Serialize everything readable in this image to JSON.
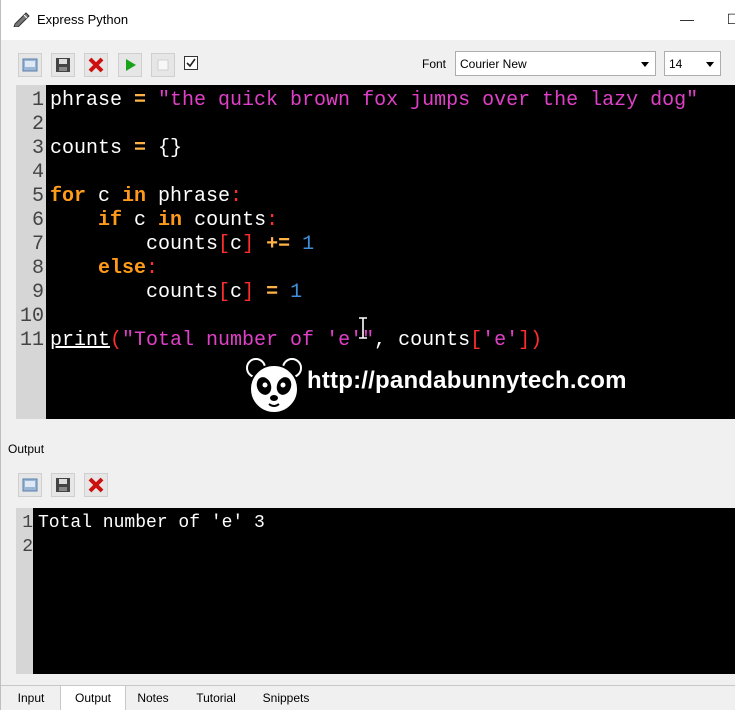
{
  "window": {
    "title": "Express Python",
    "min_glyph": "—",
    "max_glyph": "☐"
  },
  "toolbar": {
    "font_label": "Font",
    "font_value": "Courier New",
    "size_value": "14"
  },
  "editor": {
    "line_numbers": [
      "1",
      "2",
      "3",
      "4",
      "5",
      "6",
      "7",
      "8",
      "9",
      "10",
      "11"
    ],
    "line1": {
      "var": "phrase",
      "op": " = ",
      "str": "\"the quick brown fox jumps over the lazy dog\""
    },
    "line3": {
      "var": "counts",
      "op": " = ",
      "rest": "{}"
    },
    "line5": {
      "kw1": "for",
      "mid1": " c ",
      "kw2": "in",
      "mid2": " phrase",
      "colon": ":"
    },
    "line6": {
      "indent": "    ",
      "kw1": "if",
      "mid1": " c ",
      "kw2": "in",
      "mid2": " counts",
      "colon": ":"
    },
    "line7": {
      "indent": "        ",
      "var": "counts",
      "lb": "[",
      "idx": "c",
      "rb": "]",
      "op": " += ",
      "num": "1"
    },
    "line8": {
      "indent": "    ",
      "kw": "else",
      "colon": ":"
    },
    "line9": {
      "indent": "        ",
      "var": "counts",
      "lb": "[",
      "idx": "c",
      "rb": "]",
      "op": " = ",
      "num": "1"
    },
    "line11": {
      "fn": "print",
      "lp": "(",
      "str": "\"Total number of 'e'\"",
      "comma": ", counts",
      "lb": "[",
      "key": "'e'",
      "rb": "])"
    }
  },
  "watermark": {
    "url": "http://pandabunnytech.com"
  },
  "output": {
    "label": "Output",
    "line_numbers": [
      "1",
      "2"
    ],
    "lines": [
      "Total number of 'e' 3",
      ""
    ]
  },
  "tabs": [
    "Input",
    "Output",
    "Notes",
    "Tutorial",
    "Snippets"
  ],
  "colors": {
    "keyword": "#ff9a1a",
    "string": "#e040c8",
    "number": "#3e8ed9",
    "bracket": "#ff2d2d",
    "run_green": "#1aa31a",
    "clear_red": "#cc1111"
  },
  "icons": {
    "new": "new-file-icon",
    "save": "save-icon",
    "clear": "clear-x-icon",
    "run": "run-play-icon",
    "stop": "stop-icon",
    "check": "checkbox-icon",
    "app": "pen-icon",
    "mascot": "panda-icon"
  }
}
